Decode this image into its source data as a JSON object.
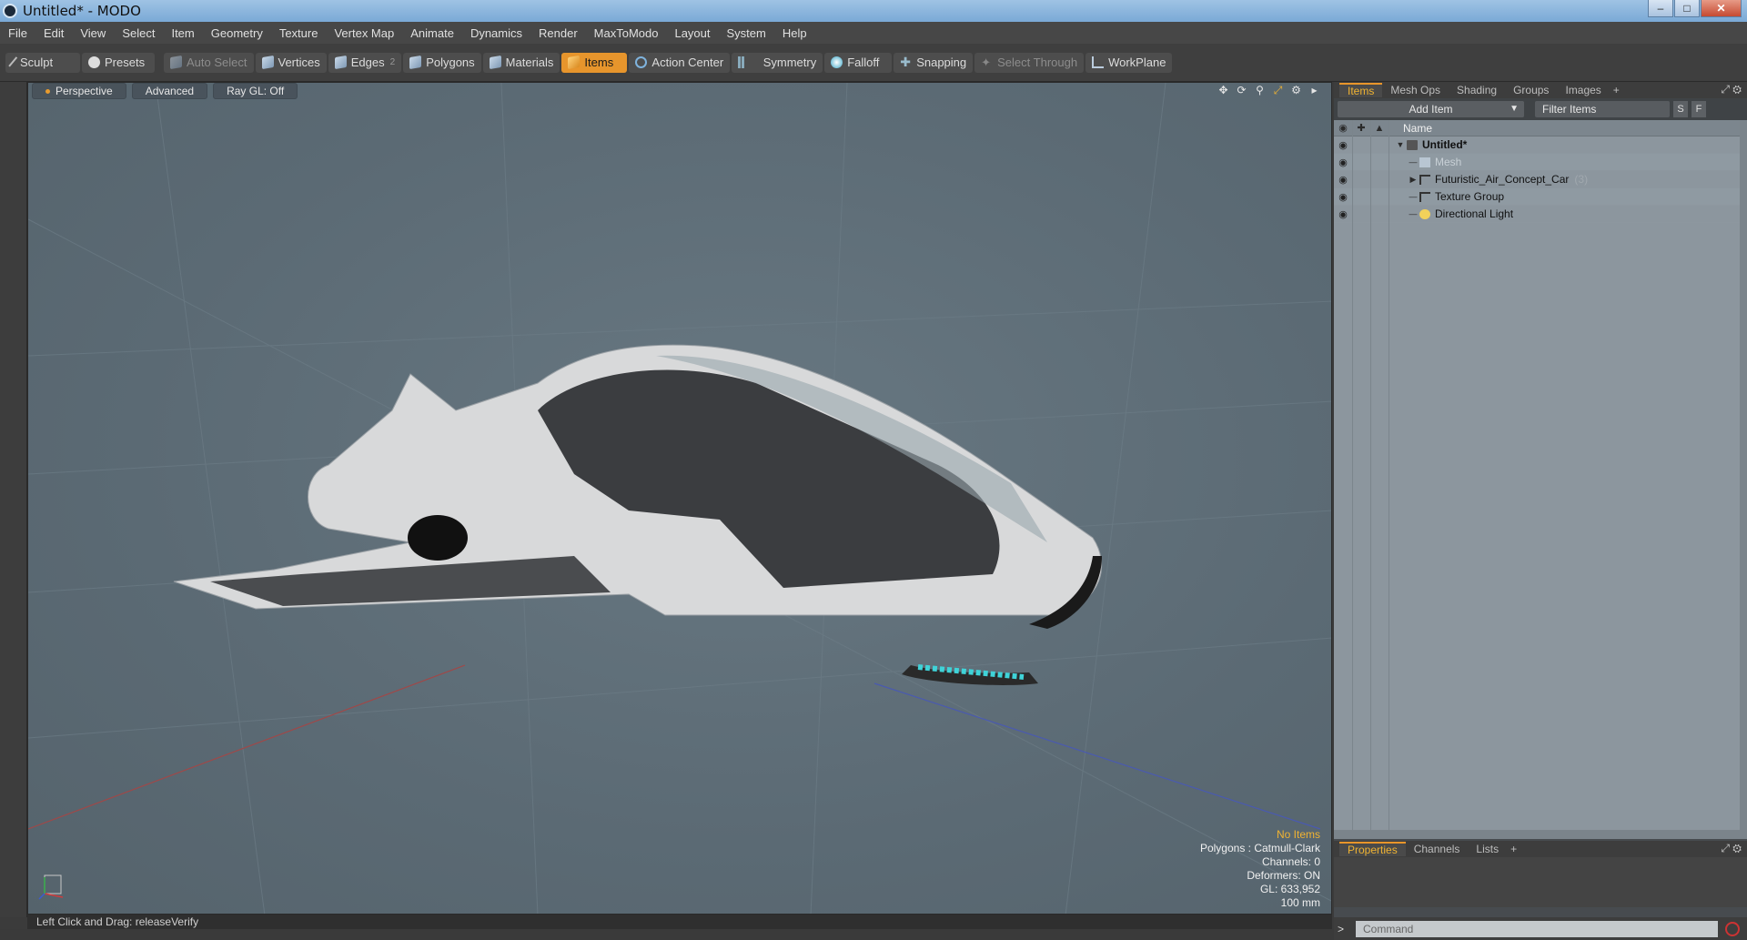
{
  "window": {
    "title": "Untitled* - MODO",
    "controls": [
      "minimize",
      "maximize",
      "close"
    ]
  },
  "menu": [
    "File",
    "Edit",
    "View",
    "Select",
    "Item",
    "Geometry",
    "Texture",
    "Vertex Map",
    "Animate",
    "Dynamics",
    "Render",
    "MaxToModo",
    "Layout",
    "System",
    "Help"
  ],
  "toolbar": {
    "sculpt": "Sculpt",
    "presets": "Presets",
    "auto_select": "Auto Select",
    "vertices": "Vertices",
    "edges": "Edges",
    "edges_count": "2",
    "polygons": "Polygons",
    "materials": "Materials",
    "items": "Items",
    "action_center": "Action Center",
    "symmetry": "Symmetry",
    "falloff": "Falloff",
    "snapping": "Snapping",
    "select_through": "Select Through",
    "workplane": "WorkPlane"
  },
  "viewport": {
    "tabs": [
      "Perspective",
      "Advanced",
      "Ray GL: Off"
    ],
    "info": {
      "selection": "No Items",
      "polygons": "Polygons : Catmull-Clark",
      "channels": "Channels: 0",
      "deformers": "Deformers: ON",
      "gl": "GL: 633,952",
      "scale": "100 mm"
    },
    "model_name": "Futuristic_Air_Concept_Car"
  },
  "status": {
    "hint": "Left Click and Drag:  releaseVerify"
  },
  "items_panel": {
    "tabs": [
      "Items",
      "Mesh Ops",
      "Shading",
      "Groups",
      "Images",
      "+"
    ],
    "add_item": "Add Item",
    "filter_placeholder": "Filter Items",
    "s_button": "S",
    "f_button": "F",
    "column_name": "Name",
    "tree": [
      {
        "label": "Untitled*",
        "level": 0
      },
      {
        "label": "Mesh",
        "level": 1
      },
      {
        "label": "Futuristic_Air_Concept_Car",
        "count": "(3)",
        "level": 1
      },
      {
        "label": "Texture Group",
        "level": 1
      },
      {
        "label": "Directional Light",
        "level": 1
      }
    ]
  },
  "properties_panel": {
    "tabs": [
      "Properties",
      "Channels",
      "Lists",
      "+"
    ]
  },
  "command": {
    "prompt": ">",
    "placeholder": "Command"
  }
}
